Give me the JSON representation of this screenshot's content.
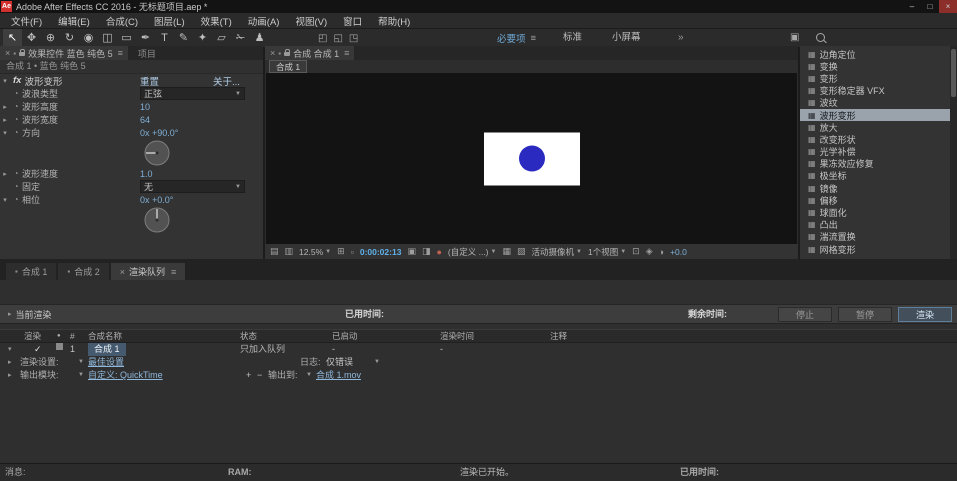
{
  "colors": {
    "accent_blue": "#7fb0d8",
    "timecode_blue": "#5fb2ea",
    "selection_bg": "#9aa3ab",
    "queue_name_bg": "#455a6e",
    "stage_rect": "#ffffff",
    "stage_circle": "#2a2ac0",
    "app_icon_red": "#d22f2f"
  },
  "icons": {
    "close": "×",
    "menu": "≡",
    "twirl_open": "▾",
    "twirl_closed": "▸",
    "dropdown": "▼",
    "stopwatch": "◔",
    "panel_square": "▪",
    "check": "✓",
    "bullet": "●",
    "minimize": "–",
    "maximize": "□",
    "win_close": "×",
    "plus": "+",
    "minus": "−",
    "grid_a": "▤",
    "grid_b": "▥",
    "region": "⊞",
    "mask": "▫",
    "snapshot": "▣",
    "half": "◨",
    "res_a": "▦",
    "res_b": "▧",
    "view_a": "⊡",
    "view_b": "◈",
    "exposure": "◑",
    "effect_item": "▦",
    "box": "▣"
  },
  "titlebar": {
    "app_icon": "Ae",
    "title": "Adobe After Effects CC 2016 - 无标题项目.aep *"
  },
  "menu": {
    "items": [
      "文件(F)",
      "编辑(E)",
      "合成(C)",
      "图层(L)",
      "效果(T)",
      "动画(A)",
      "视图(V)",
      "窗口",
      "帮助(H)"
    ]
  },
  "toolbar": {
    "tools": [
      "↖",
      "✥",
      "⊕",
      "↻",
      "◉",
      "◫",
      "▭",
      "✒",
      "T",
      "✎",
      "✦",
      "▱",
      "✁",
      "♟"
    ],
    "axis_modes": [
      "◰",
      "◱",
      "◳"
    ],
    "workspace_active": "必要项",
    "workspace_items": [
      "标准",
      "小屏幕"
    ],
    "workspace_overflow": "»"
  },
  "effect_controls": {
    "tab_title": "效果控件 蓝色 纯色 5",
    "project_tab": "项目",
    "breadcrumb": "合成 1 • 蓝色 纯色 5",
    "fx_badge": "fx",
    "effect_name": "波形变形",
    "reset": "重置",
    "about": "关于...",
    "rows": [
      {
        "twirl": "",
        "label": "波浪类型",
        "value": "正弦"
      },
      {
        "twirl": "▸",
        "label": "波形高度",
        "value": "10"
      },
      {
        "twirl": "▸",
        "label": "波形宽度",
        "value": "64"
      },
      {
        "twirl": "▾",
        "label": "方向",
        "value": "0x +90.0°"
      },
      {
        "twirl": "▸",
        "label": "波形速度",
        "value": "1.0"
      },
      {
        "twirl": "",
        "label": "固定",
        "value": "无"
      },
      {
        "twirl": "▾",
        "label": "相位",
        "value": "0x +0.0°"
      }
    ]
  },
  "viewer": {
    "tab_title": "合成 合成 1",
    "comp_tab": "合成 1",
    "zoom": "12.5%",
    "timecode": "0:00:02:13",
    "colorspace": "(自定义 ...)",
    "camera": "活动摄像机",
    "views": "1个视图",
    "exposure": "+0.0"
  },
  "effects_panel": {
    "items": [
      "边角定位",
      "变换",
      "变形",
      "变形稳定器 VFX",
      "波纹",
      "波形变形",
      "放大",
      "改变形状",
      "光学补偿",
      "果冻效应修复",
      "极坐标",
      "镜像",
      "偏移",
      "球面化",
      "凸出",
      "湍流置换",
      "网格变形"
    ],
    "selected": "波形变形"
  },
  "bottom_tabs": {
    "tabs": [
      "合成 1",
      "合成 2",
      "渲染队列"
    ]
  },
  "render_queue": {
    "current_render": "当前渲染",
    "elapsed_label": "已用时间:",
    "remaining_label": "剩余时间:",
    "stop": "停止",
    "pause": "暂停",
    "render": "渲染",
    "headers": {
      "render": "渲染",
      "num": "#",
      "name": "合成名称",
      "status": "状态",
      "started": "已启动",
      "render_time": "渲染时间",
      "comment": "注释"
    },
    "item": {
      "num": "1",
      "name": "合成 1",
      "status": "只加入队列",
      "started": "-",
      "render_time": "-"
    },
    "settings_label": "渲染设置:",
    "settings_value": "最佳设置",
    "log_label": "日志:",
    "log_value": "仅错误",
    "output_label": "输出模块:",
    "output_value": "自定义: QuickTime",
    "output_to_label": "输出到:",
    "output_to_value": "合成 1.mov"
  },
  "statusbar": {
    "message_label": "消息:",
    "ram_label": "RAM:",
    "status": "渲染已开始。",
    "elapsed_label": "已用时间:"
  }
}
